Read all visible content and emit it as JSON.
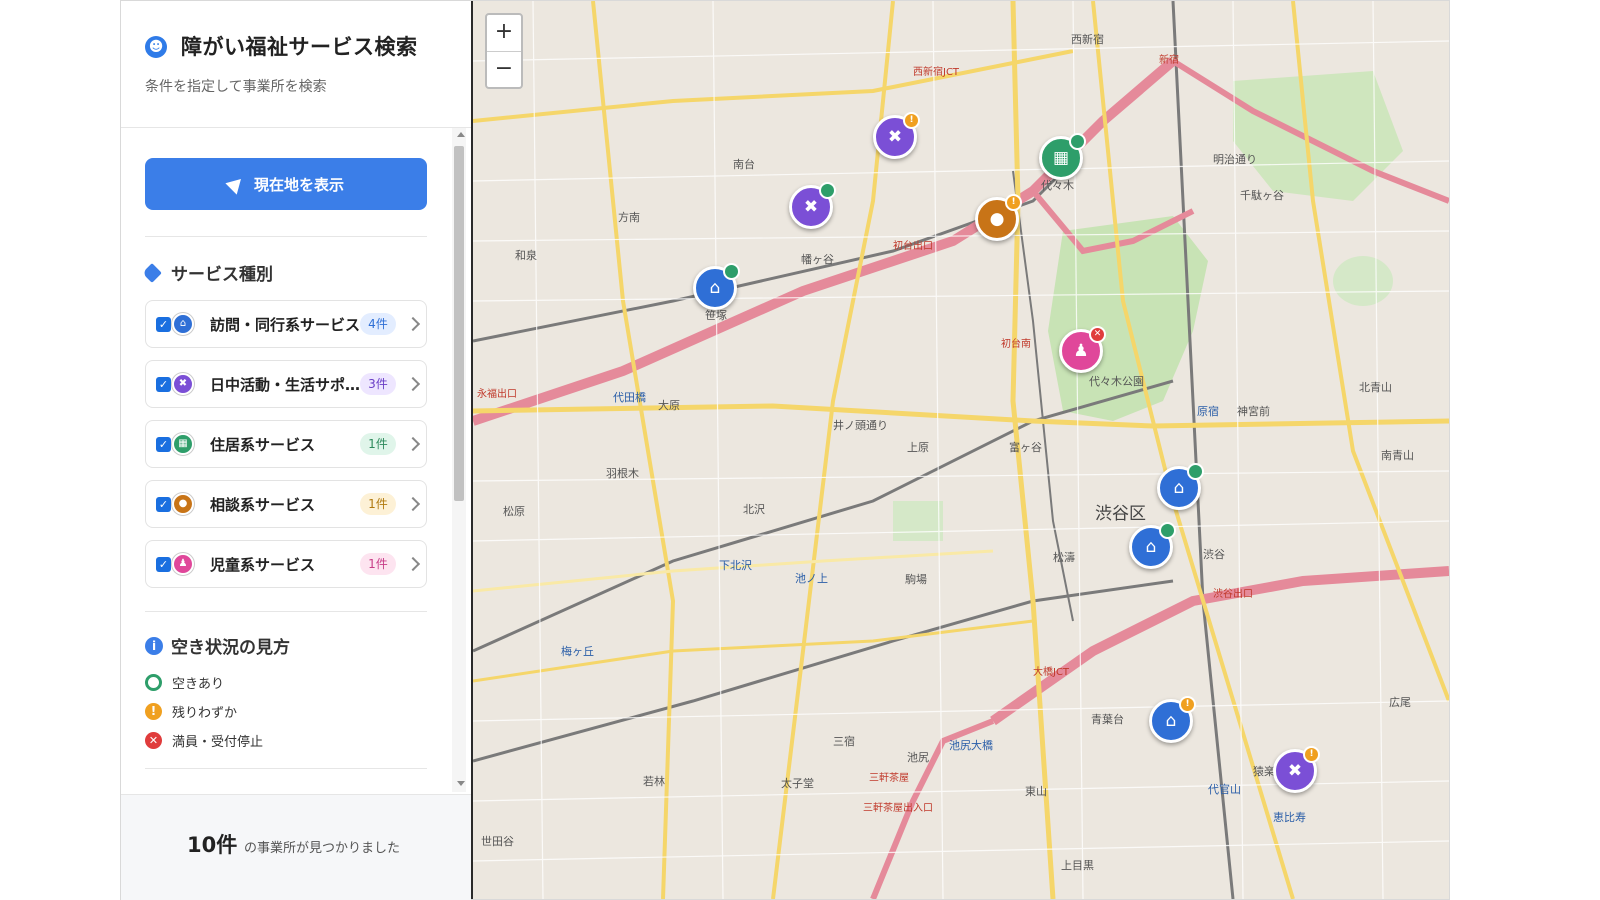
{
  "sidebar": {
    "title": "障がい福祉サービス検索",
    "subtitle": "条件を指定して事業所を検索",
    "locate_button": "現在地を表示",
    "service_section_title": "サービス種別",
    "services": [
      {
        "label": "訪問・同行系サービス",
        "count": "4件",
        "icon": "home-icon",
        "color": "#2f6fd6",
        "count_bg": "#e3edff",
        "count_color": "#2f6fd6"
      },
      {
        "label": "日中活動・生活サポ…",
        "count": "3件",
        "icon": "tools-icon",
        "color": "#7b4fd6",
        "count_bg": "#eee6ff",
        "count_color": "#6a3fc6"
      },
      {
        "label": "住居系サービス",
        "count": "1件",
        "icon": "building-icon",
        "color": "#2e9e6a",
        "count_bg": "#e0f5ea",
        "count_color": "#2e8a5c"
      },
      {
        "label": "相談系サービス",
        "count": "1件",
        "icon": "chat-icon",
        "color": "#c87417",
        "count_bg": "#fdf1d6",
        "count_color": "#b07a10"
      },
      {
        "label": "児童系サービス",
        "count": "1件",
        "icon": "child-icon",
        "color": "#e0479a",
        "count_bg": "#fde4f0",
        "count_color": "#c83d88"
      }
    ],
    "legend_title": "空き状況の見方",
    "legend": [
      {
        "label": "空きあり",
        "status": "available"
      },
      {
        "label": "残りわずか",
        "status": "few"
      },
      {
        "label": "満員・受付停止",
        "status": "full"
      }
    ],
    "result_count": "10件",
    "result_text": "の事業所が見つかりました"
  },
  "map": {
    "zoom_in": "+",
    "zoom_out": "−",
    "labels": {
      "shibuya_ku": "渋谷区",
      "yoyogi": "代々木",
      "sendagaya": "千駄ヶ谷",
      "harajuku": "原宿",
      "jingumae": "神宮前",
      "shibuya": "渋谷",
      "ebisu": "恵比寿",
      "daikanyama": "代官山",
      "hatagaya": "幡ヶ谷",
      "sasazuka": "笹塚",
      "daita": "代田橋",
      "ohara": "大原",
      "kitazawa": "北沢",
      "shimokitazawa": "下北沢",
      "ikenoue": "池ノ上",
      "komaba": "駒場",
      "ikejiri_ohashi": "池尻大橋",
      "sangenjaya": "三軒茶屋",
      "shinjuku": "新宿",
      "nishishinjuku": "西新宿",
      "minamidai": "南台",
      "honan": "方南",
      "izumi": "和泉",
      "hanegi": "羽根木",
      "matsubara": "松原",
      "umegaoka": "梅ヶ丘",
      "wakabayashi": "若林",
      "setagaya": "世田谷",
      "kamihara": "上原",
      "tomigaya": "富ヶ谷",
      "matsuba": "松濤",
      "aobadai": "青葉台",
      "ikejiri": "池尻",
      "mishuku": "三宿",
      "taishido": "太子堂",
      "higashiyama": "東山",
      "kamimeguro": "上目黒",
      "sarugakucho": "猿楽町",
      "hiroo": "広尾",
      "minami_aoyama": "南青山",
      "kita_aoyama": "北青山",
      "yoyogi_park": "代々木公園",
      "meiji_dori": "明治通り",
      "ino_kashira": "井ノ頭通り",
      "hatsudai_minami": "初台南",
      "hatsudai_iriguchi": "初台出口",
      "nishishinjuku_jct": "西新宿JCT",
      "ohashi_jct": "大橋JCT",
      "shibuya_iriguchi": "渋谷出口",
      "sangenjaya_iriguchi": "三軒茶屋出入口",
      "eifuku_iriguchi": "永福出口"
    }
  }
}
